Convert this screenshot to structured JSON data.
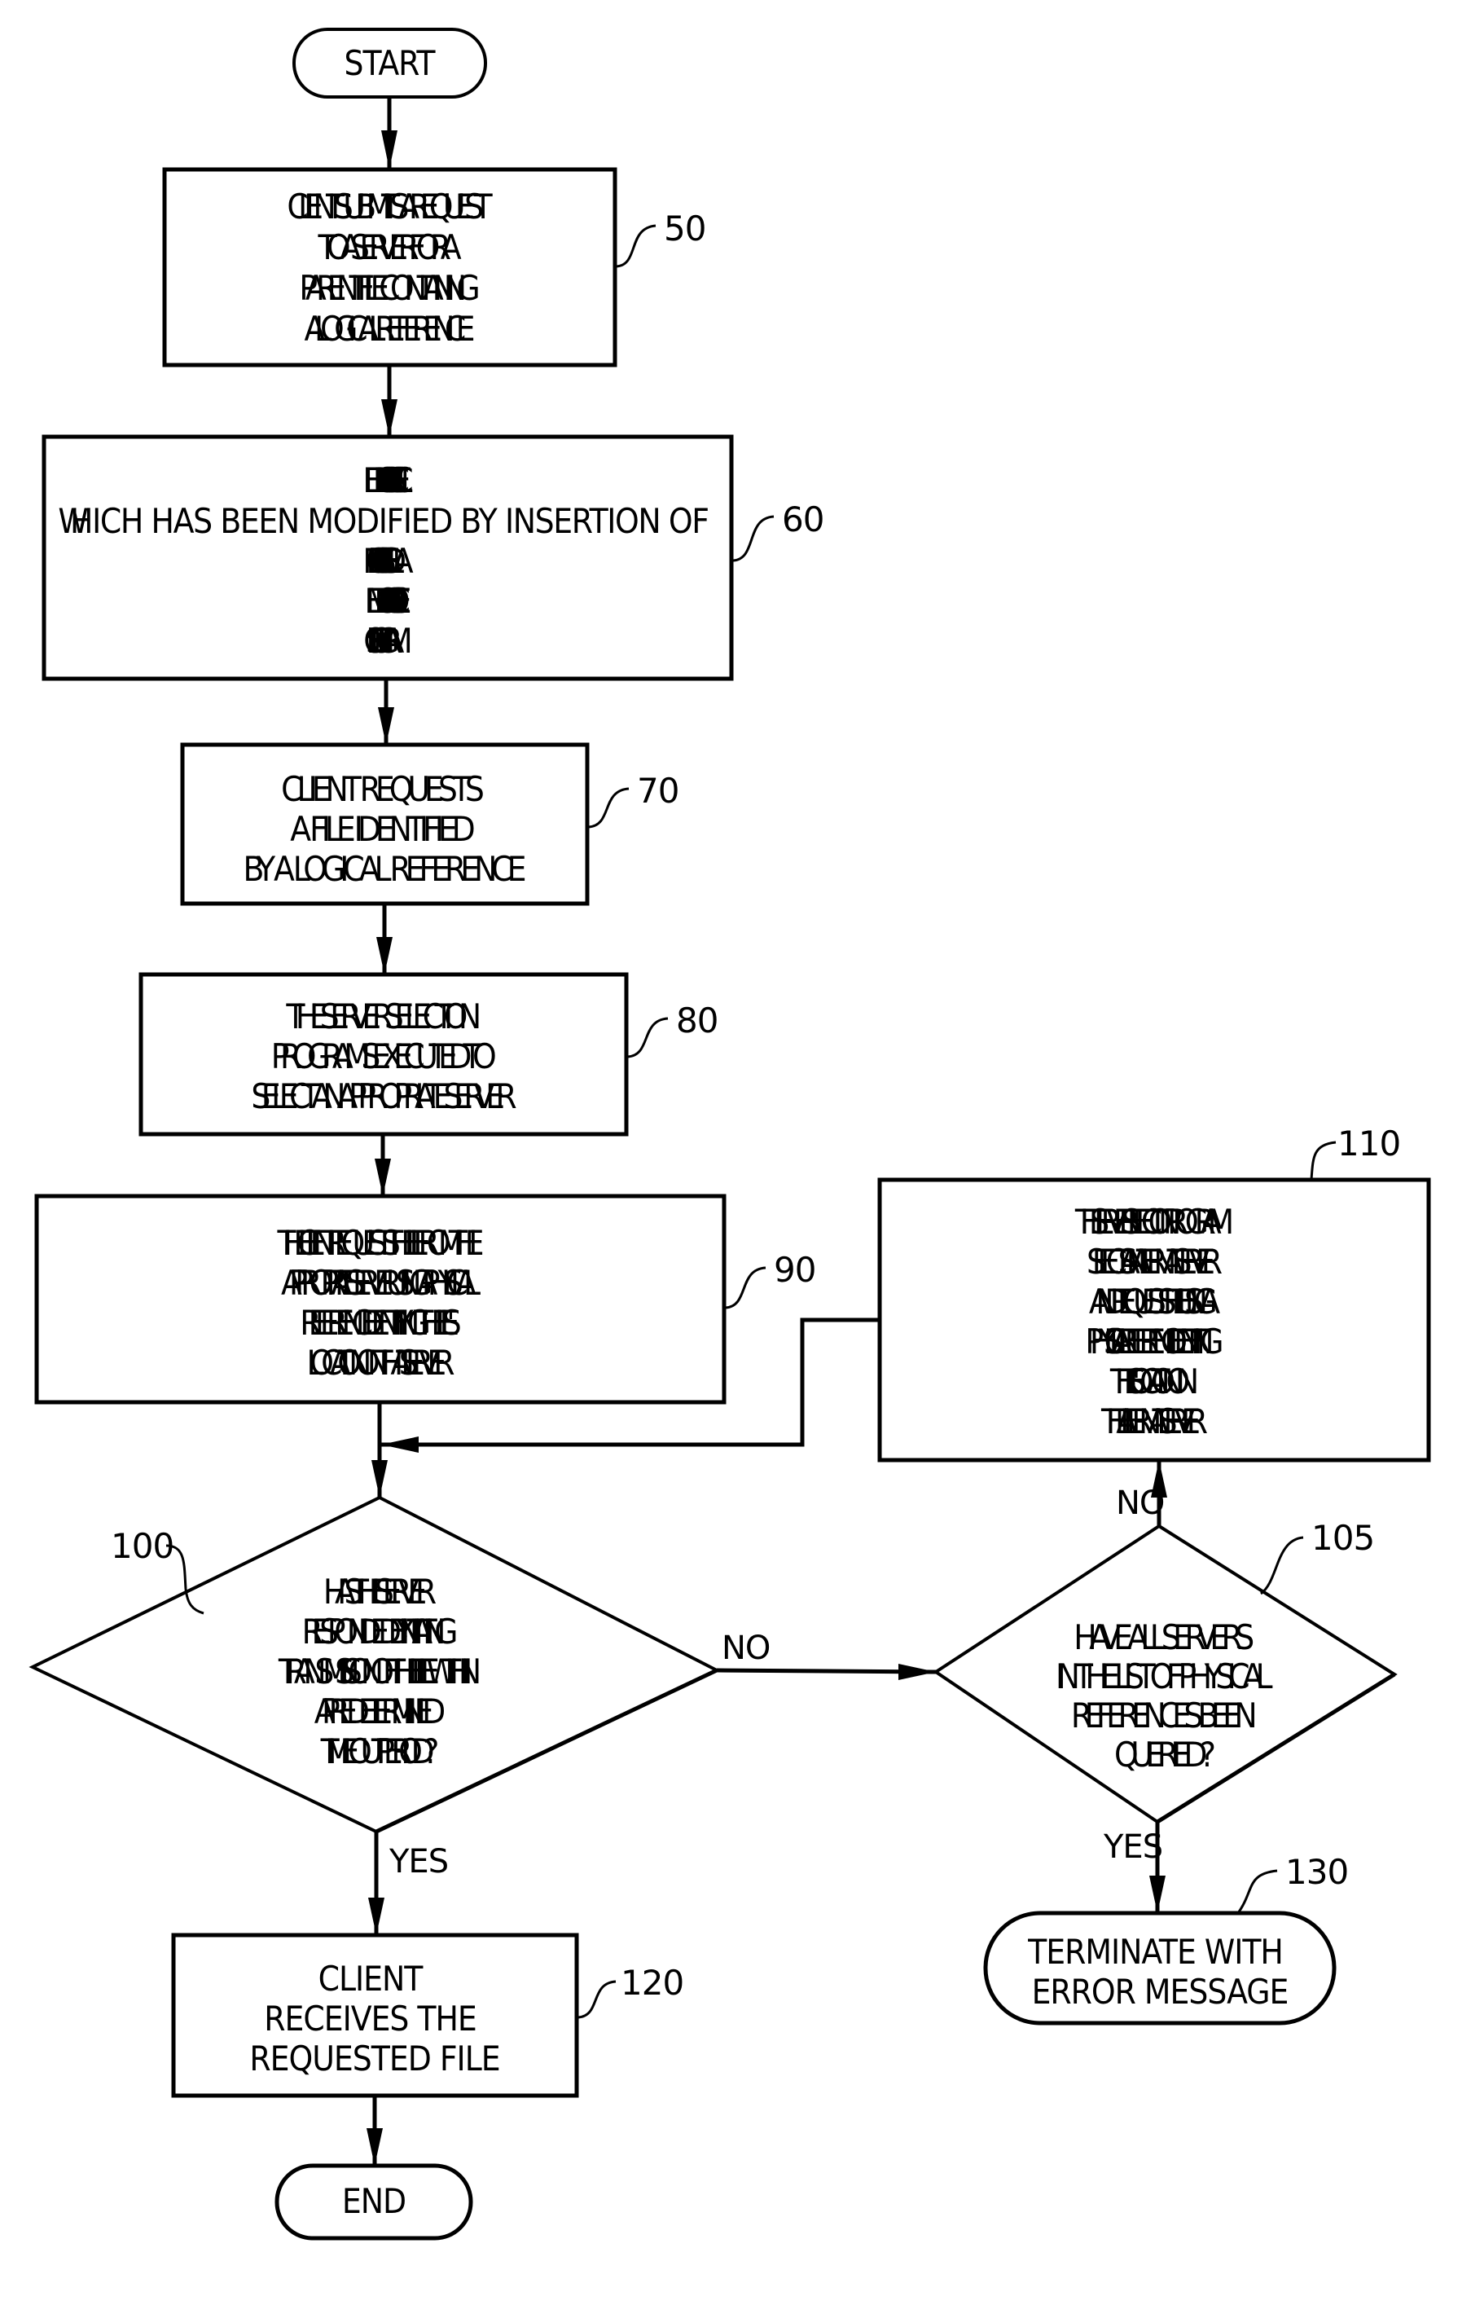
{
  "diagram": {
    "nodes": {
      "start": {
        "label": "START"
      },
      "n50": {
        "ref": "50",
        "lines": [
          "CLIENT SUBMITS A REQUEST",
          "TO A SERVER FOR A",
          "PARENT FILE CONTAINING",
          "A LOGICAL REFERENCE"
        ]
      },
      "n60": {
        "ref": "60",
        "lines": [
          "CLIENT RECEIVES A VERSION OF THE FILE",
          "WHICH HAS BEEN MODIFIED BY INSERTION OF",
          "A LIST OF PHYSICAL REFERENCES AND",
          "EMBEDDING OF A REFERENCE TO A SERVER",
          "SELECTION PROGRAM"
        ]
      },
      "n70": {
        "ref": "70",
        "lines": [
          "CLIENT REQUESTS",
          "A FILE IDENTIFIED",
          "BY A LOGICAL REFERENCE"
        ]
      },
      "n80": {
        "ref": "80",
        "lines": [
          "THE SERVER SELECTION",
          "PROGRAM IS EXECUTED TO",
          "SELECT AN APPROPRIATE SERVER"
        ]
      },
      "n90": {
        "ref": "90",
        "lines": [
          "THE CLIENT REQUESTS THE FILE FROM THE",
          "APPROPRIATE SERVER USING A PHYSICAL",
          "REFERENCE IDENTIFYING THE FILE'S",
          "LOCATION ON THAT SERVER"
        ]
      },
      "n100": {
        "ref": "100",
        "lines": [
          "HAS THE SERVER",
          "RESPONDED BY INITIATING",
          "TRANSMISSION OF THE FILE WITHIN",
          "A PREDETERMINED",
          "TIMEOUT PERIOD?"
        ]
      },
      "n105": {
        "ref": "105",
        "lines": [
          "HAVE ALL SERVERS",
          "IN THE LIST OF PHYSICAL",
          "REFERENCES BEEN",
          "QUERIED?"
        ]
      },
      "n110": {
        "ref": "110",
        "lines": [
          "THE SERVER SELECTION PROGRAM",
          "SELECTS AN ALTERNATE SERVER",
          "AND REQUESTS THE FILE USING A",
          "PHYSICAL REFERENCE IDENTIFYING",
          "THE FILE'S LOCATION ON",
          "THE ALTERNATE SERVER"
        ]
      },
      "n120": {
        "ref": "120",
        "lines": [
          "CLIENT",
          "RECEIVES THE",
          "REQUESTED FILE"
        ]
      },
      "n130": {
        "ref": "130",
        "lines": [
          "TERMINATE WITH",
          "ERROR MESSAGE"
        ]
      },
      "end": {
        "label": "END"
      }
    },
    "branches": {
      "d100_no": "NO",
      "d100_yes": "YES",
      "d105_no": "NO",
      "d105_yes": "YES"
    }
  }
}
